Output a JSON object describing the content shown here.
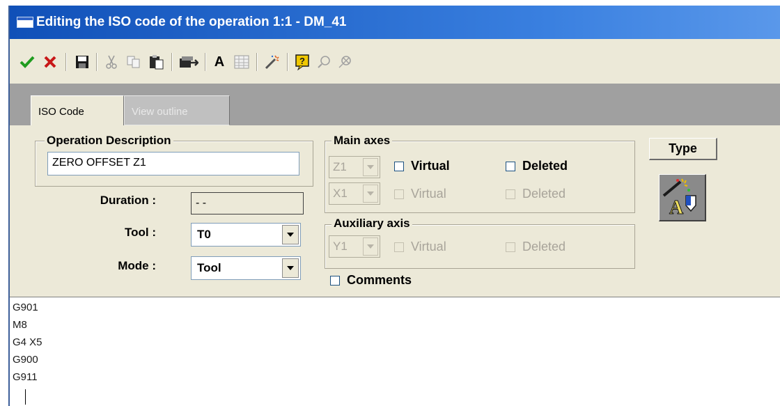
{
  "window": {
    "title": "Editing the ISO code of the operation 1:1 - DM_41"
  },
  "toolbar": {
    "icons": [
      "check-icon",
      "cross-icon",
      "save-icon",
      "cut-icon",
      "copy-icon",
      "paste-icon",
      "export-icon",
      "font-icon",
      "grid-icon",
      "wand-icon",
      "help-icon",
      "zoom-in-icon",
      "zoom-out-icon"
    ],
    "font_glyph": "A"
  },
  "tabs": [
    {
      "label": "ISO Code"
    },
    {
      "label": "View outline"
    }
  ],
  "operation": {
    "group_title": "Operation Description",
    "description": "ZERO OFFSET Z1",
    "duration_label": "Duration :",
    "duration_value": "- -",
    "tool_label": "Tool :",
    "tool_value": "T0",
    "mode_label": "Mode :",
    "mode_value": "Tool"
  },
  "main_axes": {
    "title": "Main axes",
    "axis1": "Z1",
    "axis2": "X1",
    "virtual_label": "Virtual",
    "deleted_label": "Deleted"
  },
  "aux_axis": {
    "title": "Auxiliary axis",
    "axis": "Y1",
    "virtual_label": "Virtual",
    "deleted_label": "Deleted"
  },
  "comments_label": "Comments",
  "type_button": "Type",
  "code_lines": [
    "G901",
    "M8",
    "G4 X5",
    "G900",
    "G911"
  ],
  "colors": {
    "title_bar": "#1050b8",
    "window_bg": "#ece9d8",
    "tab_band": "#a0a0a0",
    "check_green": "#1f9c1f",
    "cross_red": "#c81818"
  }
}
